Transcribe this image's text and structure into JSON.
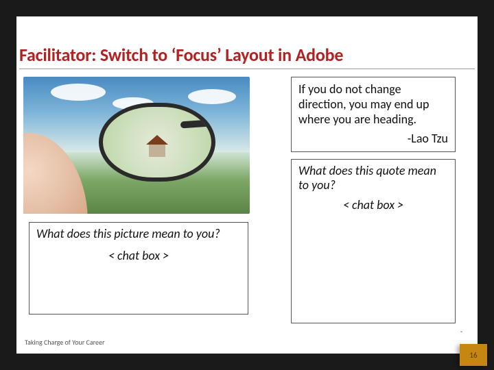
{
  "title": "Facilitator: Switch to ‘Focus’ Layout in Adobe",
  "quote": {
    "text": "If you do not change direction, you may end up where you are heading.",
    "attribution": "-Lao Tzu"
  },
  "right_prompt": {
    "question": "What does this quote mean to you?",
    "placeholder": "< chat box >"
  },
  "left_prompt": {
    "question": "What does this picture mean to you?",
    "placeholder": "< chat box >"
  },
  "footer": "Taking Charge of Your Career",
  "page_number": "16",
  "page_tick": "-"
}
